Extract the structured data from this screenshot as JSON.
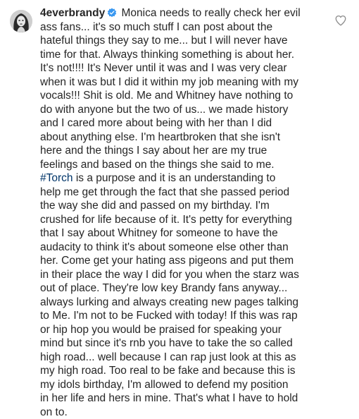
{
  "comment": {
    "username": "4everbrandy",
    "icons": {
      "avatar": "profile-avatar",
      "verified": "verified-badge-icon",
      "like": "heart-outline-icon"
    },
    "colors": {
      "verified": "#3897f0",
      "hashtag": "#003569",
      "text": "#262626"
    },
    "lines": [
      " Monica needs to really check her evil",
      "ass fans... it's so much stuff I can post about the",
      "hateful things they say to me... but I will never have",
      "time for that. Always thinking something is about her.",
      "It's not!!!! It's Never until it was and I was very clear",
      "when it was but I did it within my job meaning with my",
      "vocals!!! Shit is old. Me and Whitney have nothing to",
      "do with anyone but the two of us... we made history",
      "and I cared more about being with her than I did",
      "about anything else. I'm heartbroken that she isn't",
      "here and the things I say about her are my true",
      "feelings and based on the things she said to me.",
      " is a purpose and it is an understanding to",
      "help me get through the fact that she passed period",
      "the way she did and passed on my birthday. I'm",
      "crushed for life because of it. It's petty for everything",
      "that I say about Whitney for someone to have the",
      "audacity to think it's about someone else other than",
      "her. Come get your hating ass pigeons and put them",
      "in their place the way I did for you when the starz was",
      "out of place. They're low key Brandy fans anyway...",
      "always lurking and always creating new pages talking",
      "to Me. I'm not to be Fucked with today! If this was rap",
      "or hip hop you would be praised for speaking your",
      "mind but since it's rnb you have to take the so called",
      "high road... well because I can rap just look at this as",
      "my high road. Too real to be fake and because this is",
      "my idols birthday, I'm allowed to defend my position",
      "in her life and hers in mine. That's what I have to hold",
      "on to."
    ],
    "hashtag": "#Torch"
  }
}
